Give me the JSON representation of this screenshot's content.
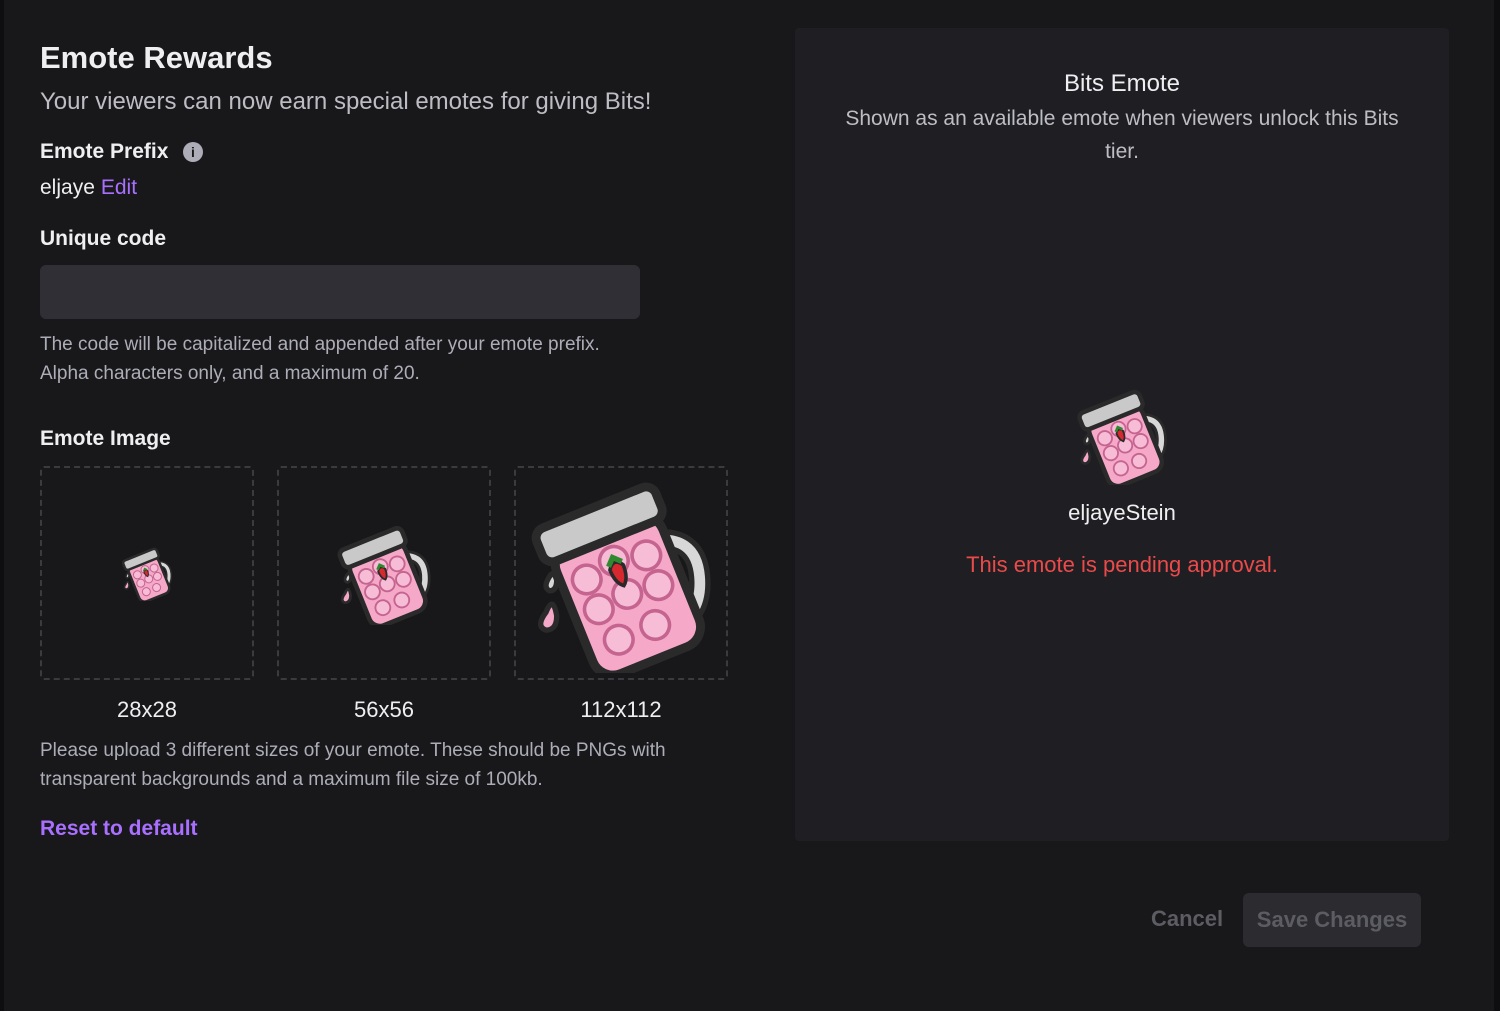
{
  "header": {
    "title": "Emote Rewards",
    "subtitle": "Your viewers can now earn special emotes for giving Bits!"
  },
  "prefix": {
    "label": "Emote Prefix",
    "info_icon": "info-icon",
    "value": "eljaye",
    "edit_label": "Edit"
  },
  "unique_code": {
    "label": "Unique code",
    "value": "",
    "help": "The code will be capitalized and appended after your emote prefix. Alpha characters only, and a maximum of 20."
  },
  "emote_image": {
    "label": "Emote Image",
    "sizes": [
      "28x28",
      "56x56",
      "112x112"
    ],
    "help": "Please upload 3 different sizes of your emote. These should be PNGs with transparent backgrounds and a maximum file size of 100kb.",
    "reset_label": "Reset to default"
  },
  "preview": {
    "title": "Bits Emote",
    "description": "Shown as an available emote when viewers unlock this Bits tier.",
    "emote_name": "eljayeStein",
    "status": "This emote is pending approval."
  },
  "footer": {
    "cancel_label": "Cancel",
    "save_label": "Save Changes"
  },
  "colors": {
    "background": "#18181b",
    "panel": "#1f1f23",
    "accent": "#a970ff",
    "error": "#eb4a4a"
  }
}
